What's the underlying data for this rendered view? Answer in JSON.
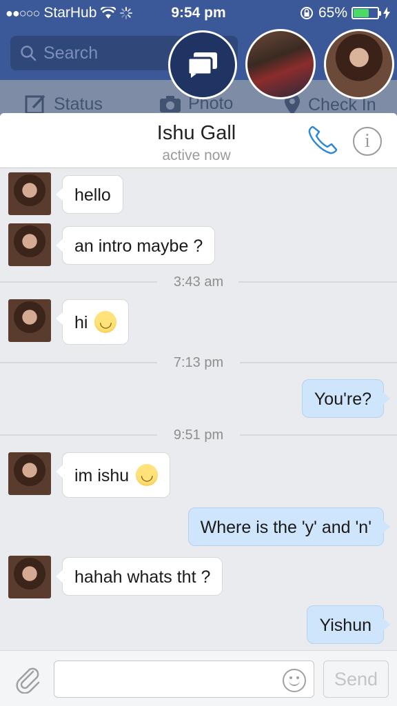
{
  "status_bar": {
    "signal": "●●○○○",
    "carrier": "StarHub",
    "time": "9:54 pm",
    "battery_text": "65%",
    "battery_level": 0.65,
    "battery_color": "#4cd964"
  },
  "background": {
    "search_placeholder": "Search",
    "actions": [
      {
        "label": "Status",
        "icon": "edit-icon"
      },
      {
        "label": "Photo",
        "icon": "camera-icon"
      },
      {
        "label": "Check In",
        "icon": "location-pin-icon"
      }
    ],
    "brand_color": "#3b5998"
  },
  "chat_heads": [
    {
      "name": "messages-chathead",
      "icon": "chat-bubbles-icon"
    },
    {
      "name": "contact-photo-1"
    },
    {
      "name": "contact-photo-ishu"
    }
  ],
  "chat": {
    "contact_name": "Ishu Gall",
    "status": "active now",
    "phone_icon": "phone-icon",
    "info_icon": "info-icon",
    "info_glyph": "i"
  },
  "messages": [
    {
      "from": "them",
      "text": "hello",
      "emoji": false
    },
    {
      "from": "them",
      "text": "an intro maybe ?",
      "emoji": false
    },
    {
      "type": "timestamp",
      "text": "3:43 am"
    },
    {
      "from": "them",
      "text": "hi",
      "emoji": true
    },
    {
      "type": "timestamp",
      "text": "7:13 pm"
    },
    {
      "from": "me",
      "text": "You're?"
    },
    {
      "type": "timestamp",
      "text": "9:51 pm"
    },
    {
      "from": "them",
      "text": "im ishu",
      "emoji": true
    },
    {
      "from": "me",
      "text": "Where is the 'y' and 'n'"
    },
    {
      "from": "them",
      "text": "hahah whats tht ?",
      "emoji": false
    },
    {
      "from": "me",
      "text": "Yishun"
    }
  ],
  "composer": {
    "input_value": "",
    "send_label": "Send",
    "attach_icon": "paperclip-icon",
    "emoji_icon": "smiley-icon"
  },
  "colors": {
    "outgoing_bubble": "#cfe5fb",
    "incoming_bubble": "#ffffff",
    "accent": "#2d88d9"
  }
}
